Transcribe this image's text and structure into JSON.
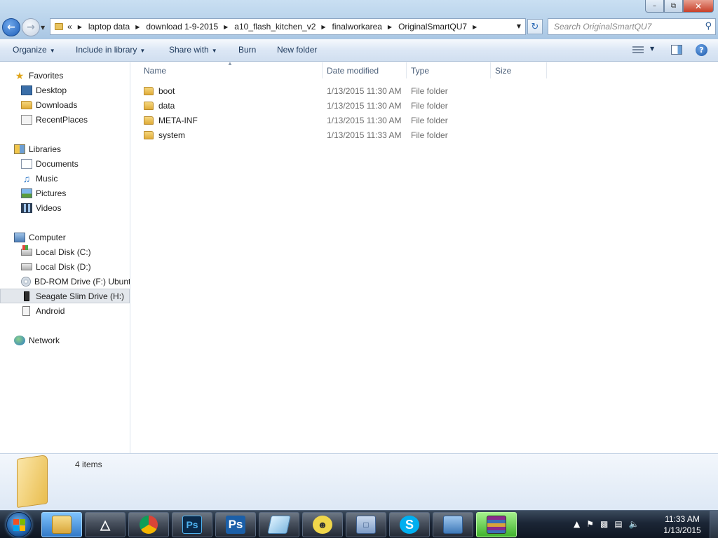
{
  "window": {
    "minimize": "–",
    "maximize": "⧉",
    "close": "✕"
  },
  "address": {
    "overflow": "«",
    "crumbs": [
      "laptop data",
      "download 1-9-2015",
      "a10_flash_kitchen_v2",
      "finalworkarea",
      "OriginalSmartQU7"
    ]
  },
  "search": {
    "placeholder": "Search OriginalSmartQU7"
  },
  "toolbar": {
    "organize": "Organize",
    "include_in_library": "Include in library",
    "share_with": "Share with",
    "burn": "Burn",
    "new_folder": "New folder"
  },
  "nav": {
    "favorites": "Favorites",
    "desktop": "Desktop",
    "downloads": "Downloads",
    "recent_places": "RecentPlaces",
    "libraries": "Libraries",
    "documents": "Documents",
    "music": "Music",
    "pictures": "Pictures",
    "videos": "Videos",
    "computer": "Computer",
    "local_c": "Local Disk (C:)",
    "local_d": "Local Disk (D:)",
    "bd_rom": "BD-ROM Drive (F:) Ubunt",
    "seagate": "Seagate Slim Drive (H:)",
    "android": "Android",
    "network": "Network"
  },
  "columns": {
    "name": "Name",
    "date_modified": "Date modified",
    "type": "Type",
    "size": "Size"
  },
  "files": [
    {
      "name": "boot",
      "date": "1/13/2015 11:30 AM",
      "type": "File folder"
    },
    {
      "name": "data",
      "date": "1/13/2015 11:30 AM",
      "type": "File folder"
    },
    {
      "name": "META-INF",
      "date": "1/13/2015 11:30 AM",
      "type": "File folder"
    },
    {
      "name": "system",
      "date": "1/13/2015 11:33 AM",
      "type": "File folder"
    }
  ],
  "details": {
    "count": "4 items"
  },
  "taskbar": {
    "photoshop_label": "Ps",
    "photoshop2_label": "Ps",
    "skype_label": "S",
    "time": "11:33 AM",
    "date": "1/13/2015"
  },
  "colors": {
    "accent": "#1f5fb8",
    "toolbar_text": "#1e395b",
    "column_header_text": "#4c607a",
    "selected_nav": "#e3e7ec"
  }
}
